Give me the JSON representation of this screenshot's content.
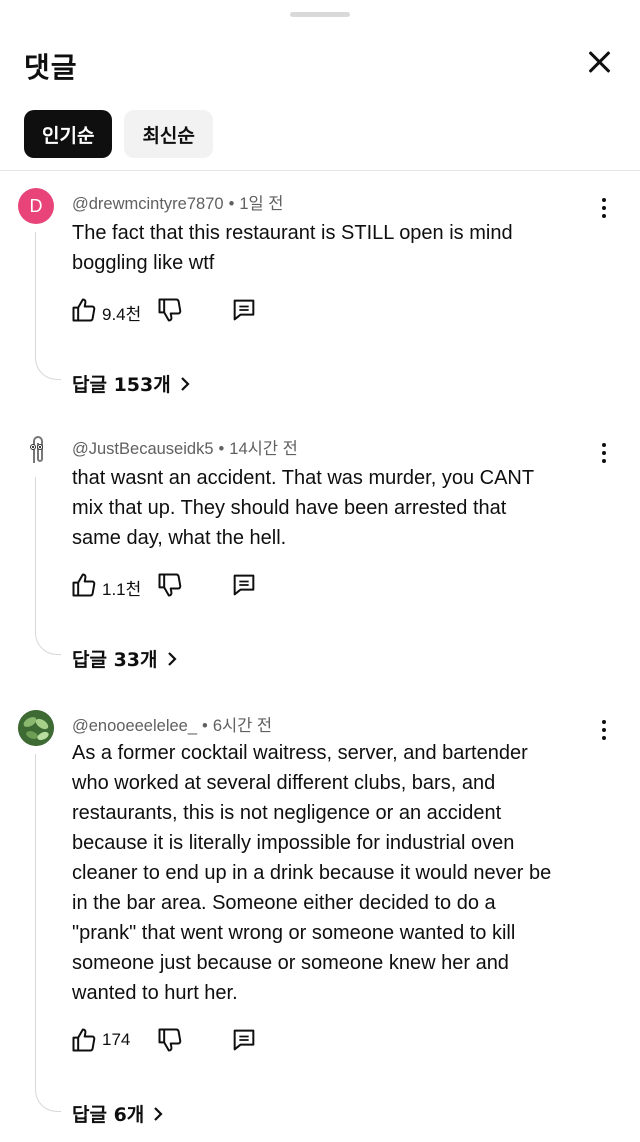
{
  "header": {
    "title": "댓글"
  },
  "sort_chips": [
    {
      "label": "인기순",
      "active": true
    },
    {
      "label": "최신순",
      "active": false
    }
  ],
  "comments": [
    {
      "avatar_letter": "D",
      "author": "@drewmcintyre7870",
      "time": "1일 전",
      "lines": [
        "The fact that this restaurant is STILL open is mind",
        "boggling like wtf"
      ],
      "likes": "9.4천",
      "replies": "답글 153개"
    },
    {
      "avatar_letter": "",
      "author": "@JustBecauseidk5",
      "time": "14시간 전",
      "lines": [
        "that wasnt an accident. That was murder, you CANT",
        "mix that up. They should have been arrested that",
        "same day, what the hell."
      ],
      "likes": "1.1천",
      "replies": "답글 33개"
    },
    {
      "avatar_letter": "",
      "author": "@enooeeelelee_",
      "time": "6시간 전",
      "lines": [
        "As a former cocktail waitress, server, and bartender",
        "who worked at several different clubs, bars, and",
        "restaurants, this is not negligence or an accident",
        "because it is literally impossible for industrial oven",
        "cleaner to end up in a drink because it would never be",
        "in the bar area. Someone either decided to do a",
        "\"prank\" that went wrong or someone wanted to kill",
        "someone just because or someone knew her and",
        "wanted to hurt her."
      ],
      "likes": "174",
      "replies": "답글 6개"
    }
  ],
  "colors": {
    "avatar_d": "#e8447a",
    "text": "#0f0f0f",
    "meta": "#606060",
    "chip_active": "#0f0f0f",
    "chip_inactive": "#f2f2f2"
  }
}
